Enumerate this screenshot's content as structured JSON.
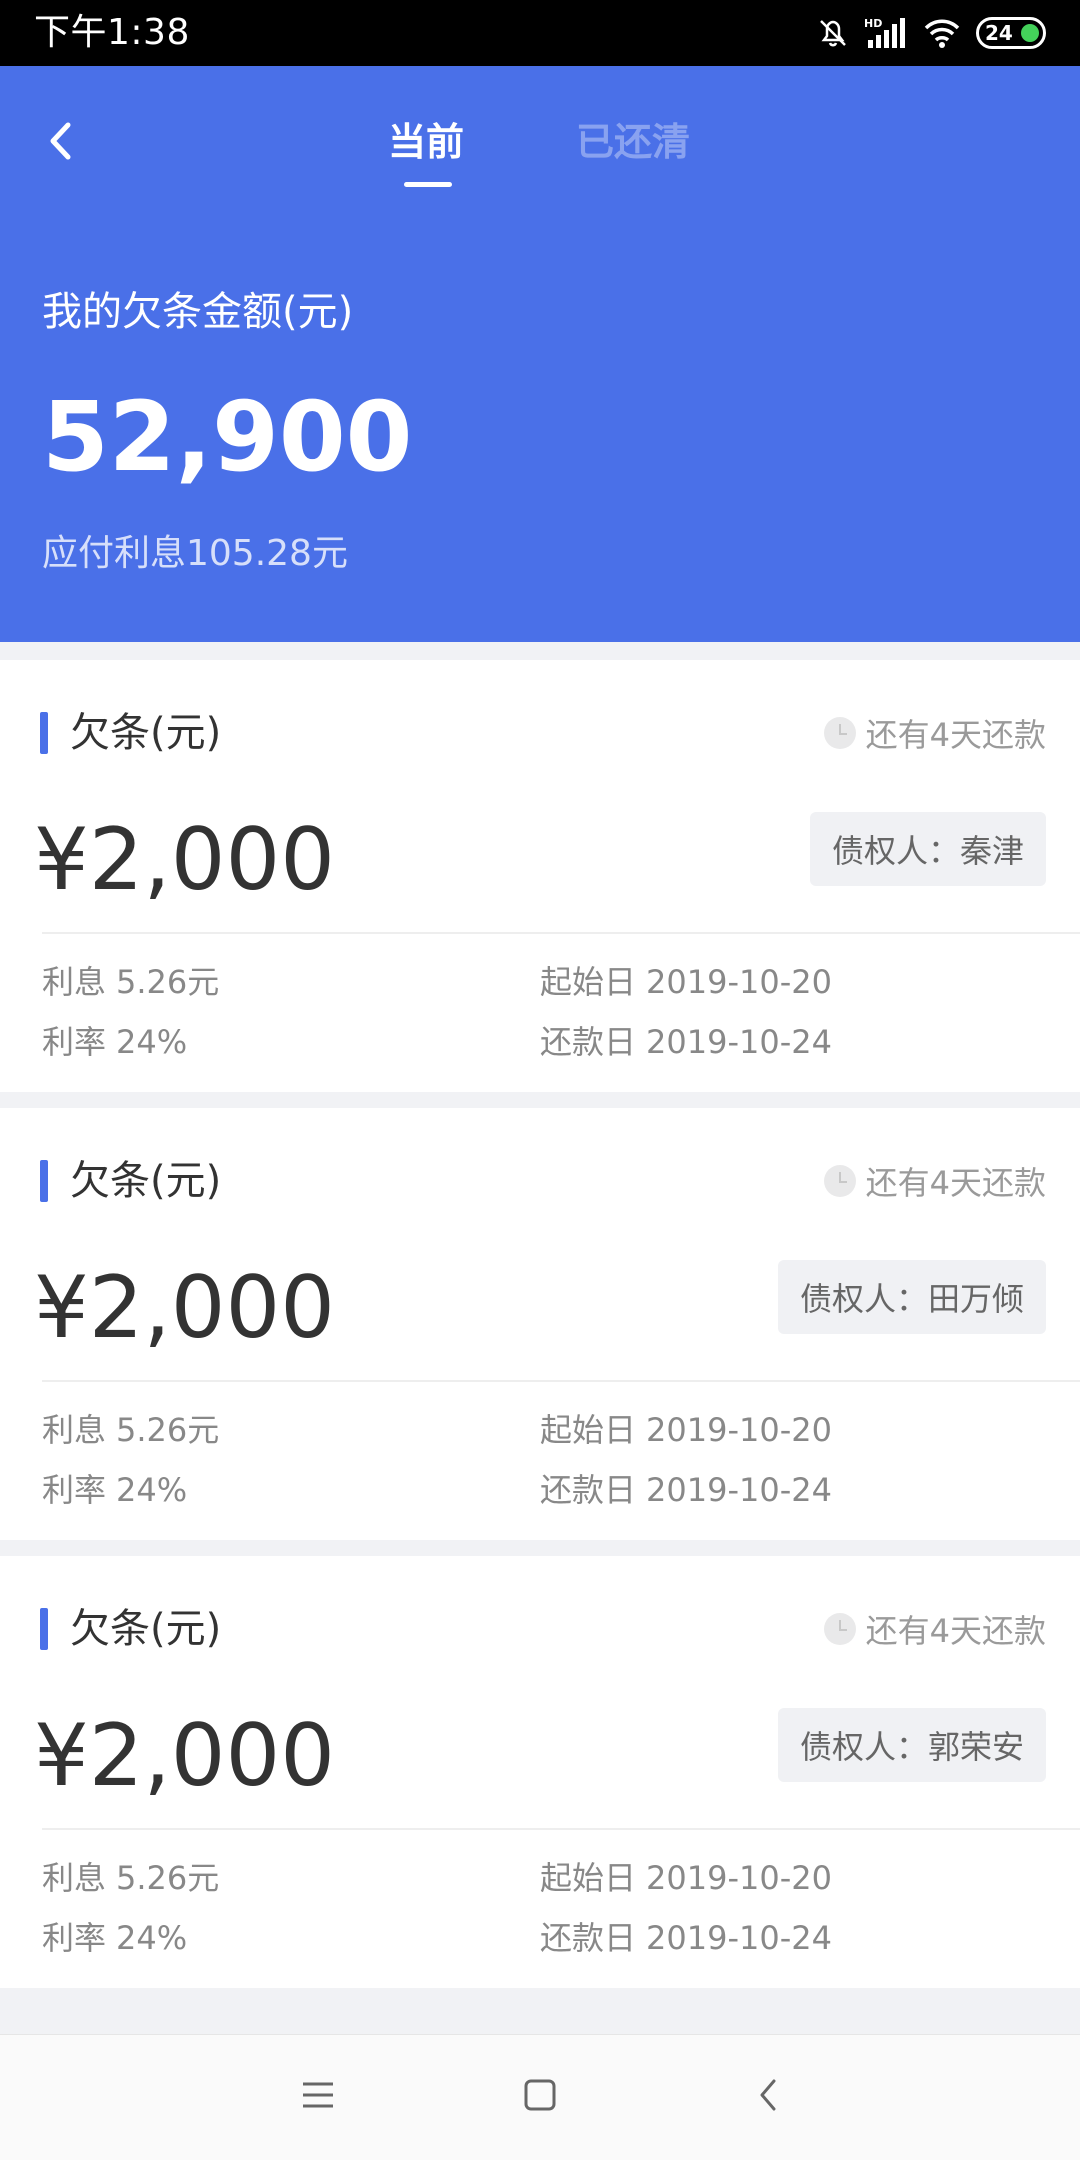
{
  "status_bar": {
    "time": "下午1:38",
    "battery": "24",
    "icons": [
      "mute-icon",
      "hd-signal-icon",
      "wifi-icon",
      "battery-icon"
    ]
  },
  "header": {
    "tabs": [
      {
        "label": "当前",
        "active": true
      },
      {
        "label": "已还清",
        "active": false
      }
    ],
    "amount_label": "我的欠条金额(元)",
    "amount": "52,900",
    "interest_text": "应付利息105.28元"
  },
  "colors": {
    "primary": "#4a70e8",
    "background": "#f1f2f5"
  },
  "cards": [
    {
      "title": "欠条(元)",
      "due_text": "还有4天还款",
      "amount": "¥2,000",
      "creditor": "债权人：秦津",
      "interest_label": "利息",
      "interest_value": "5.26元",
      "rate_label": "利率",
      "rate_value": "24%",
      "start_label": "起始日",
      "start_value": "2019-10-20",
      "repay_label": "还款日",
      "repay_value": "2019-10-24"
    },
    {
      "title": "欠条(元)",
      "due_text": "还有4天还款",
      "amount": "¥2,000",
      "creditor": "债权人：田万倾",
      "interest_label": "利息",
      "interest_value": "5.26元",
      "rate_label": "利率",
      "rate_value": "24%",
      "start_label": "起始日",
      "start_value": "2019-10-20",
      "repay_label": "还款日",
      "repay_value": "2019-10-24"
    },
    {
      "title": "欠条(元)",
      "due_text": "还有4天还款",
      "amount": "¥2,000",
      "creditor": "债权人：郭荣安",
      "interest_label": "利息",
      "interest_value": "5.26元",
      "rate_label": "利率",
      "rate_value": "24%",
      "start_label": "起始日",
      "start_value": "2019-10-20",
      "repay_label": "还款日",
      "repay_value": "2019-10-24"
    }
  ],
  "nav_bar": {
    "buttons": [
      "menu-icon",
      "home-icon",
      "back-icon"
    ]
  }
}
